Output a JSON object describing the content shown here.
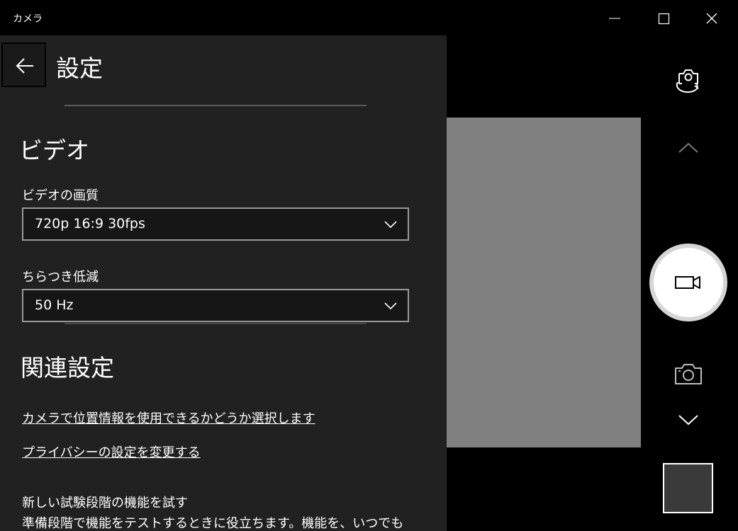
{
  "window": {
    "title": "カメラ"
  },
  "settings": {
    "title": "設定",
    "video_section": {
      "heading": "ビデオ",
      "quality_label": "ビデオの画質",
      "quality_value": "720p 16:9 30fps",
      "flicker_label": "ちらつき低減",
      "flicker_value": "50 Hz"
    },
    "related_section": {
      "heading": "関連設定",
      "link_location": "カメラで位置情報を使用できるかどうか選択します",
      "link_privacy": "プライバシーの設定を変更する"
    },
    "preview_features": {
      "title": "新しい試験段階の機能を試す",
      "description": "準備段階で機能をテストするときに役立ちます。機能を、いつでも"
    }
  },
  "icons": {
    "back": "back-arrow-icon",
    "minimize": "minimize-icon",
    "maximize": "maximize-icon",
    "close": "close-icon",
    "switch_camera": "switch-camera-icon",
    "chevron_up": "chevron-up-icon",
    "video": "video-camera-icon",
    "photo": "photo-camera-icon",
    "chevron_down": "chevron-down-icon",
    "dropdown": "chevron-down-icon"
  },
  "colors": {
    "panel_background": "#212121",
    "app_background": "#000000",
    "preview": "#808080"
  }
}
